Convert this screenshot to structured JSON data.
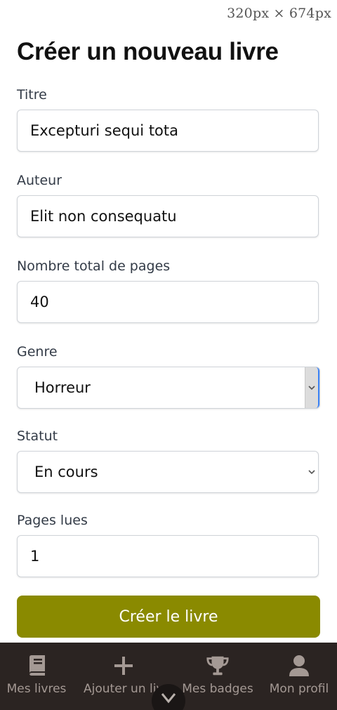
{
  "viewport_readout": "320px × 674px",
  "page": {
    "title": "Créer un nouveau livre"
  },
  "form": {
    "title_label": "Titre",
    "title_value": "Excepturi sequi tota",
    "author_label": "Auteur",
    "author_value": "Elit non consequatu",
    "total_pages_label": "Nombre total de pages",
    "total_pages_value": "40",
    "genre_label": "Genre",
    "genre_value": "Horreur",
    "status_label": "Statut",
    "status_value": "En cours",
    "pages_read_label": "Pages lues",
    "pages_read_value": "1",
    "submit_label": "Créer le livre"
  },
  "nav": {
    "items": [
      {
        "label": "Mes livres",
        "icon": "book-icon"
      },
      {
        "label": "Ajouter un livre",
        "icon": "plus-icon"
      },
      {
        "label": "Mes badges",
        "icon": "trophy-icon"
      },
      {
        "label": "Mon profil",
        "icon": "user-icon"
      }
    ]
  },
  "colors": {
    "accent": "#8a8a00",
    "nav_background": "#2b2422",
    "nav_text": "#a49994"
  }
}
